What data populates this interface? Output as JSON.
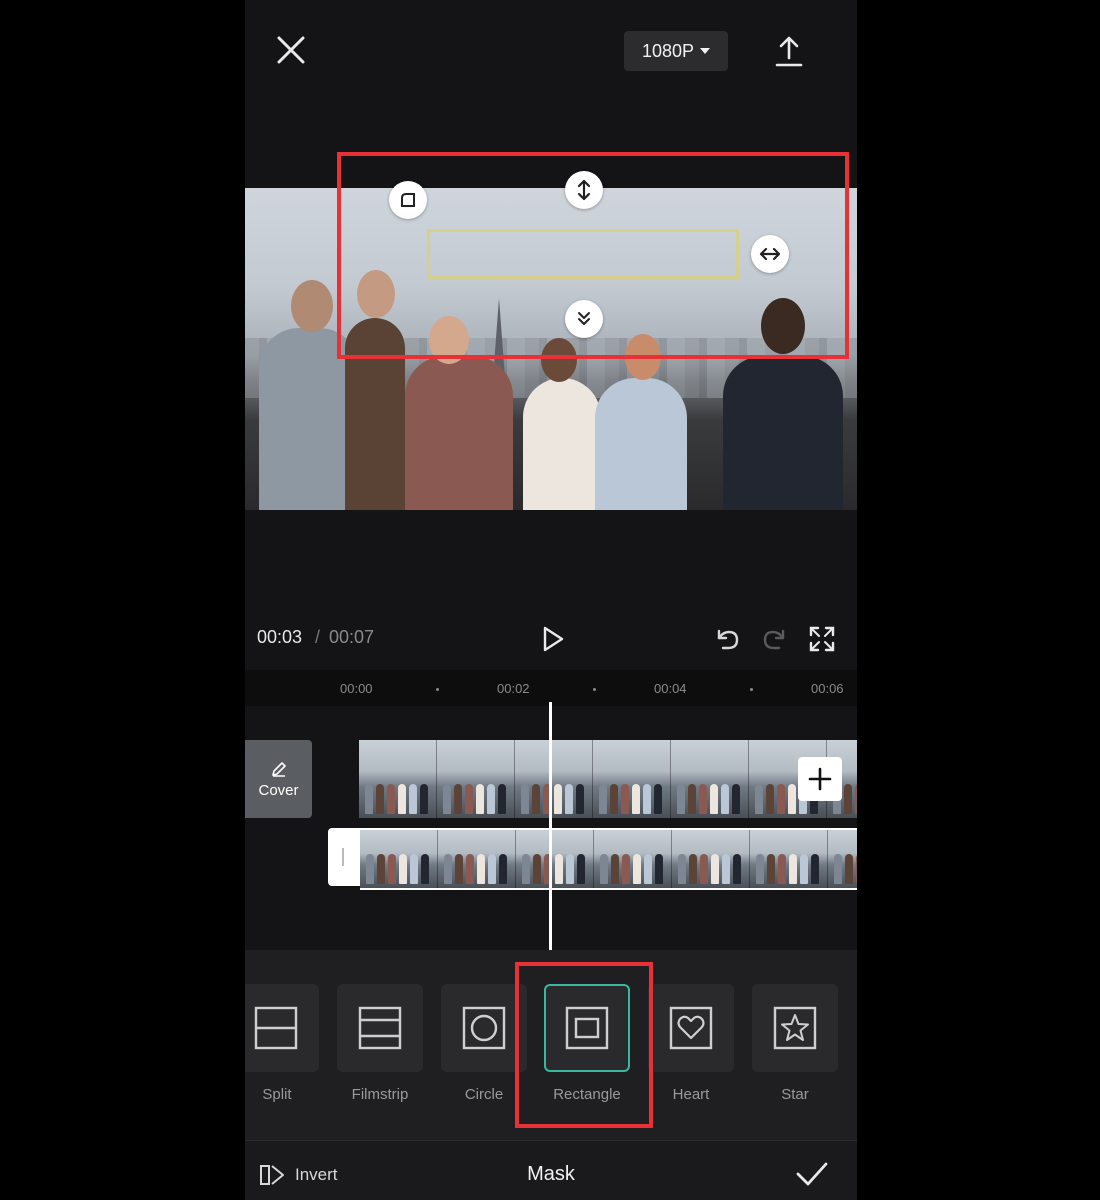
{
  "topbar": {
    "resolution": "1080P",
    "close_icon": "close-icon",
    "export_icon": "export-icon",
    "resolution_caret_icon": "caret-down-icon"
  },
  "preview": {
    "handles": [
      "feather-handle-icon",
      "vertical-resize-icon",
      "horizontal-resize-icon",
      "rotate-handle-icon"
    ]
  },
  "playback": {
    "current_time": "00:03",
    "separator": "/",
    "total_time": "00:07",
    "icons": [
      "play-icon",
      "undo-icon",
      "redo-icon",
      "fullscreen-icon"
    ]
  },
  "timeline": {
    "ruler": [
      "00:00",
      "00:02",
      "00:04",
      "00:06"
    ],
    "cover_label": "Cover",
    "add_icon": "plus-icon"
  },
  "mask_options": [
    {
      "label": "Split",
      "icon": "split-icon"
    },
    {
      "label": "Filmstrip",
      "icon": "filmstrip-icon"
    },
    {
      "label": "Circle",
      "icon": "circle-icon"
    },
    {
      "label": "Rectangle",
      "icon": "rectangle-icon",
      "selected": true
    },
    {
      "label": "Heart",
      "icon": "heart-icon"
    },
    {
      "label": "Star",
      "icon": "star-icon"
    }
  ],
  "bottom_bar": {
    "invert_label": "Invert",
    "title": "Mask",
    "confirm_icon": "check-icon"
  },
  "colors": {
    "highlight": "#e63237",
    "selected_border": "#39b8a0",
    "mask_outline": "#d9cf7a"
  }
}
